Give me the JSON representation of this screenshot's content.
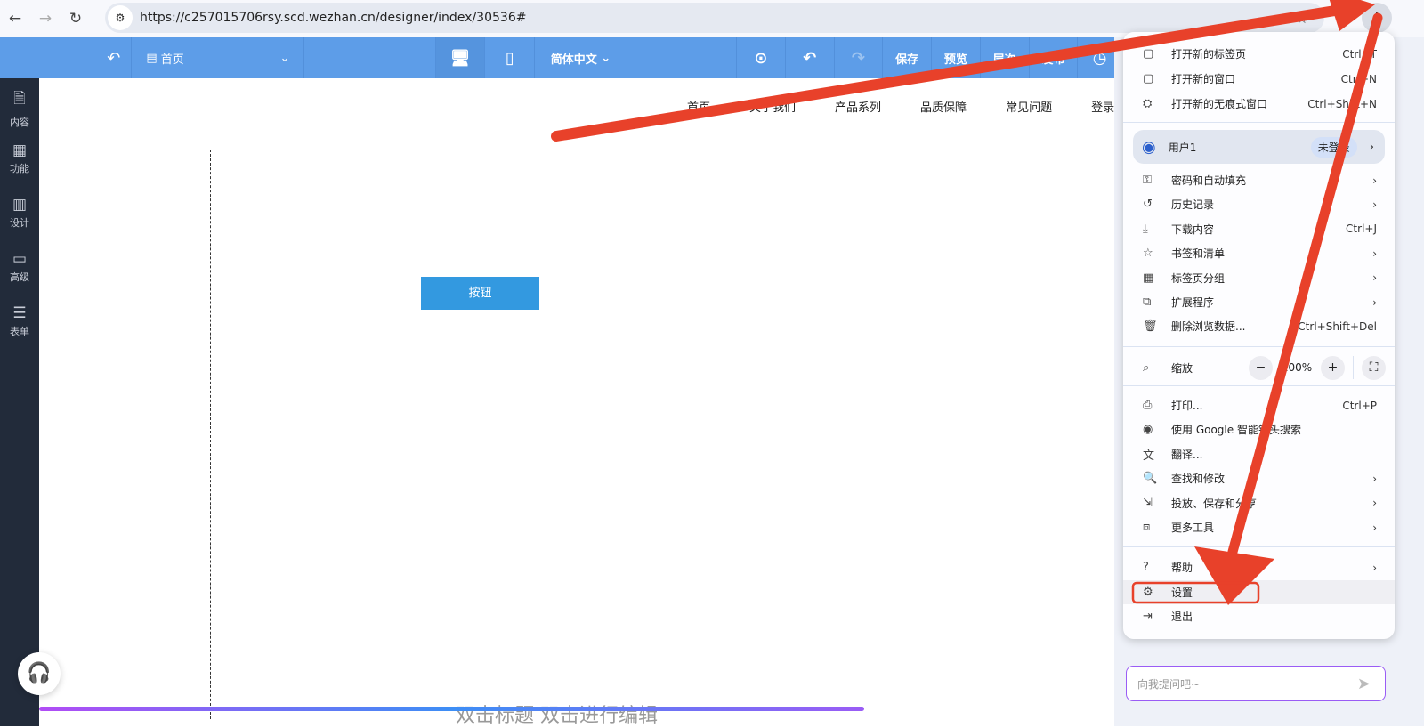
{
  "browser": {
    "url": "https://c257015706rsy.scd.wezhan.cn/designer/index/30536#"
  },
  "toolbar": {
    "page": "首页",
    "language": "简体中文",
    "save": "保存",
    "preview": "预览",
    "layers": "层次",
    "publish": "发布"
  },
  "sidebar": [
    {
      "icon": "content-icon",
      "label": "内容"
    },
    {
      "icon": "function-icon",
      "label": "功能"
    },
    {
      "icon": "design-icon",
      "label": "设计"
    },
    {
      "icon": "advanced-icon",
      "label": "高级"
    },
    {
      "icon": "form-icon",
      "label": "表单"
    }
  ],
  "site_nav": [
    "首页",
    "关于我们",
    "产品系列",
    "品质保障",
    "常见问题",
    "登录"
  ],
  "canvas": {
    "button": "按钮",
    "hint": "双击标题 双击进行编辑"
  },
  "menu": {
    "top": [
      {
        "label": "打开新的标签页",
        "shortcut": "Ctrl+T"
      },
      {
        "label": "打开新的窗口",
        "shortcut": "Ctrl+N"
      },
      {
        "label": "打开新的无痕式窗口",
        "shortcut": "Ctrl+Shift+N"
      }
    ],
    "user": {
      "name": "用户1",
      "status": "未登录"
    },
    "mid": [
      {
        "label": "密码和自动填充",
        "shortcut": "›"
      },
      {
        "label": "历史记录",
        "shortcut": "›"
      },
      {
        "label": "下载内容",
        "shortcut": "Ctrl+J"
      },
      {
        "label": "书签和清单",
        "shortcut": "›"
      },
      {
        "label": "标签页分组",
        "shortcut": "›"
      },
      {
        "label": "扩展程序",
        "shortcut": "›"
      },
      {
        "label": "删除浏览数据...",
        "shortcut": "Ctrl+Shift+Del"
      }
    ],
    "zoom": {
      "label": "缩放",
      "value": "100%"
    },
    "tools": [
      {
        "label": "打印...",
        "shortcut": "Ctrl+P"
      },
      {
        "label": "使用 Google 智能镜头搜索",
        "shortcut": ""
      },
      {
        "label": "翻译...",
        "shortcut": ""
      },
      {
        "label": "查找和修改",
        "shortcut": "›"
      },
      {
        "label": "投放、保存和分享",
        "shortcut": "›"
      },
      {
        "label": "更多工具",
        "shortcut": "›"
      }
    ],
    "bottom": [
      {
        "label": "帮助",
        "shortcut": "›"
      },
      {
        "label": "设置",
        "shortcut": ""
      },
      {
        "label": "退出",
        "shortcut": ""
      }
    ]
  },
  "chat": {
    "placeholder": "向我提问吧~"
  },
  "colors": {
    "toolbar": "#5d9de8",
    "sidebar": "#222b3a",
    "annotation": "#e8412a"
  }
}
